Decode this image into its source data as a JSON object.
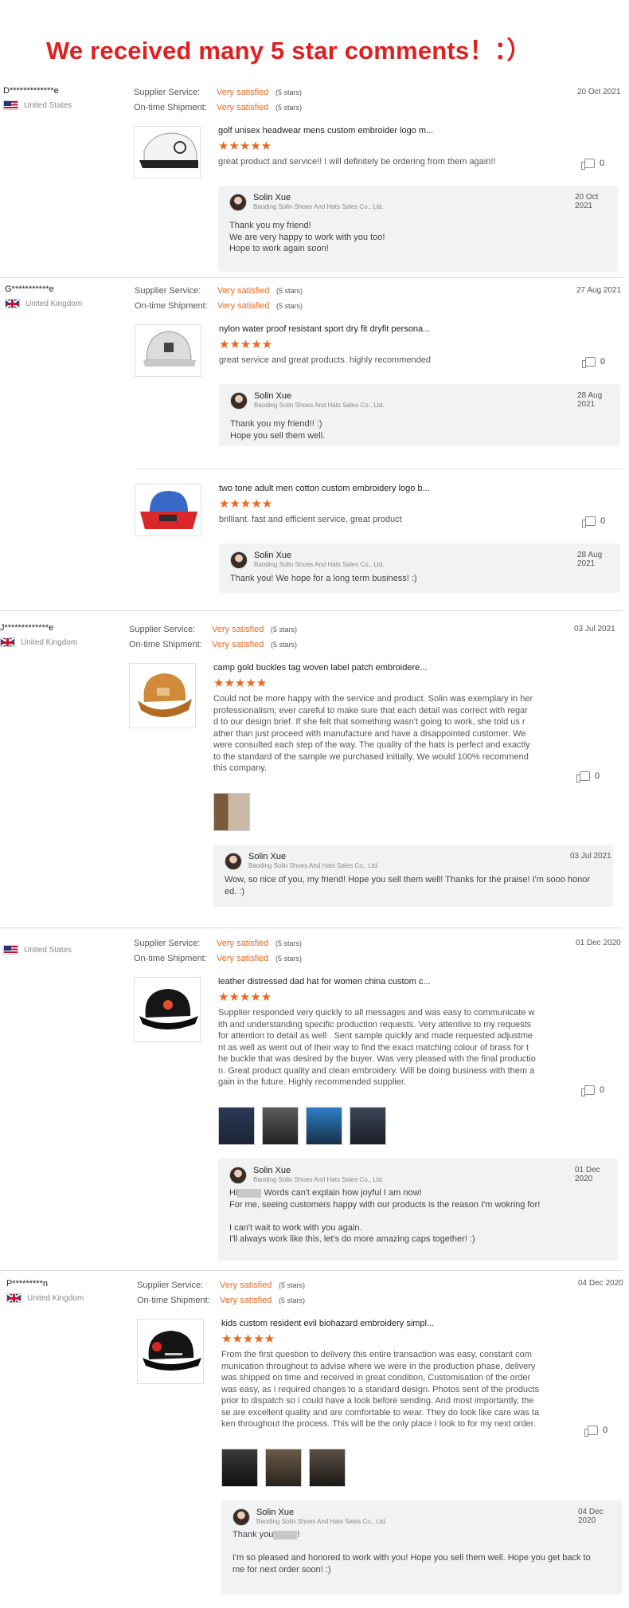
{
  "headline": "We received many 5 star comments！：）",
  "labels": {
    "supplier_service": "Supplier Service:",
    "ontime_shipment": "On-time Shipment:",
    "rating_text": "Very satisfied",
    "rating_stars": "(5 stars)",
    "stars": "★★★★★"
  },
  "reviews": [
    {
      "buyer": "D*************e",
      "country": "United States",
      "date": "20 Oct 2021",
      "items": [
        {
          "title": "golf unisex headwear mens custom embroider logo m...",
          "text": "great product and service!! I will definitely be ordering from them again!!",
          "likes": "0",
          "reply": {
            "name": "Solin Xue",
            "company": "Baoding Solin Shoes And Hats Sales Co., Ltd.",
            "date": "20 Oct 2021",
            "lines": [
              "Thank you my friend!",
              "We are very happy to work with you too!",
              "Hope to work again soon!"
            ]
          }
        }
      ]
    },
    {
      "buyer": "G***********e",
      "country": "United Kingdom",
      "date": "27 Aug 2021",
      "items": [
        {
          "title": "nylon water proof resistant sport dry fit dryfit persona...",
          "text": "great service and great products. highly recommended",
          "likes": "0",
          "reply": {
            "name": "Solin Xue",
            "company": "Baoding Solin Shoes And Hats Sales Co., Ltd.",
            "date": "28 Aug 2021",
            "lines": [
              "Thank you my friend!! :)",
              "Hope you sell them well."
            ]
          }
        },
        {
          "title": "two tone adult men cotton custom embroidery logo b...",
          "text": "brilliant. fast and efficient service, great product",
          "likes": "0",
          "reply": {
            "name": "Solin Xue",
            "company": "Baoding Solin Shoes And Hats Sales Co., Ltd.",
            "date": "28 Aug 2021",
            "lines": [
              "Thank you! We hope for a long term business! :)"
            ]
          }
        }
      ]
    },
    {
      "buyer": "J*************e",
      "country": "United Kingdom",
      "date": "03 Jul 2021",
      "items": [
        {
          "title": "camp gold buckles tag woven label patch embroidere...",
          "text_lines": [
            "Could not be more happy with the service and product. Solin was exemplary in her",
            "professionalism; ever careful to make sure that each detail was correct with regar",
            "d to our design brief. If she felt that something wasn't going to work, she told us r",
            "ather than just proceed with manufacture and have a disappointed customer. We",
            "were consulted each step of the way. The quality of the hats is perfect and exactly",
            "to the standard of the sample we purchased initially. We would 100% recommend",
            "this company."
          ],
          "likes": "0",
          "reply": {
            "name": "Solin Xue",
            "company": "Baoding Solin Shoes And Hats Sales Co., Ltd.",
            "date": "03 Jul 2021",
            "lines": [
              "Wow, so nice of you, my friend! Hope you sell them well! Thanks for the praise! I'm sooo honor",
              "ed. :)"
            ]
          }
        }
      ]
    },
    {
      "buyer": "",
      "country": "United States",
      "date": "01 Dec 2020",
      "items": [
        {
          "title": "leather distressed dad hat for women china custom c...",
          "text_lines": [
            "Supplier responded very quickly to all messages and was easy to communicate w",
            "ith and understanding specific production requests. Very attentive to my requests",
            "for attention to detail as well . Sent sample quickly and made requested adjustme",
            "nt as well as went out of their way to find the exact matching colour of brass for t",
            "he buckle that was desired by the buyer. Was very pleased with the final productio",
            "n. Great product quality and clean embroidery. Will be doing business with them a",
            "gain in the future. Highly recommended supplier."
          ],
          "likes": "0",
          "reply": {
            "name": "Solin Xue",
            "company": "Baoding Solin Shoes And Hats Sales Co., Ltd.",
            "date": "01 Dec 2020",
            "hi": "Hi",
            "hi_rest": " Words can't explain how joyful I am now!",
            "lines": [
              "For me, seeing customers happy with our products is the reason I'm wokring for!",
              "",
              "I can't wait to work with you again.",
              "I'll always work like this, let's do more amazing caps together! :)"
            ]
          }
        }
      ]
    },
    {
      "buyer": "P*********n",
      "country": "United Kingdom",
      "date": "04 Dec 2020",
      "items": [
        {
          "title": "kids custom resident evil biohazard embroidery simpl...",
          "text_lines": [
            "From the first question to delivery this entire transaction was easy, constant com",
            "munication throughout to advise where we were in the production phase, delivery",
            "was shipped on time and received in great condition, Customisation of the order",
            "was easy, as i required changes to a standard design. Photos sent of the products",
            "prior to dispatch so i could have a look before sending. And most importantly, the",
            "se are excellent quality and are comfortable to wear. They do look like care was ta",
            "ken throughout the process. This will be the only place I look to for my next order."
          ],
          "likes": "0",
          "reply": {
            "name": "Solin Xue",
            "company": "Baoding Solin Shoes And Hats Sales Co., Ltd.",
            "date": "04 Dec 2020",
            "hi": "Thank you",
            "hi_rest": "!",
            "lines": [
              "",
              "I'm so pleased and honored to work with you! Hope you sell them well. Hope you get back to",
              "me for next order soon! :)"
            ]
          }
        }
      ]
    }
  ]
}
